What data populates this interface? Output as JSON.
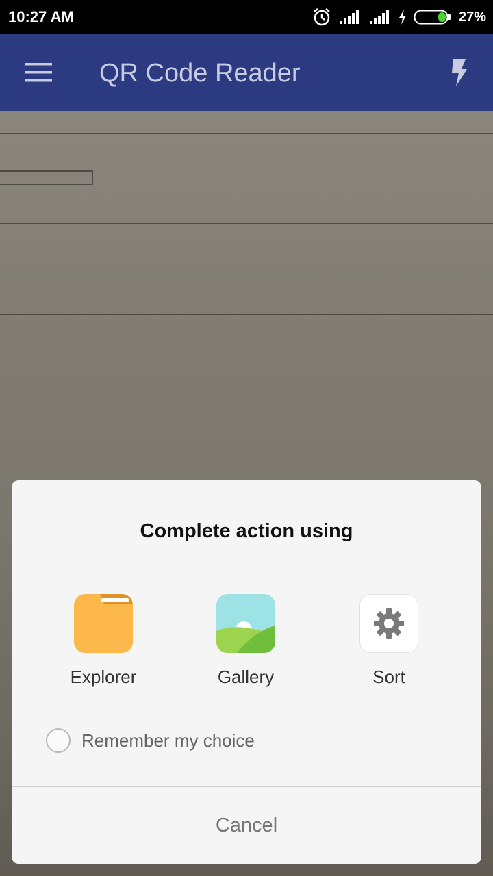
{
  "status_bar": {
    "time": "10:27 AM",
    "battery_percent": "27%",
    "icons": [
      "alarm-icon",
      "signal-icon",
      "signal-icon",
      "charging-icon",
      "battery-icon"
    ]
  },
  "app_bar": {
    "title": "QR Code Reader",
    "menu_icon": "hamburger-menu-icon",
    "flash_icon": "flash-icon",
    "color": "#2c3a82"
  },
  "dialog": {
    "title": "Complete action using",
    "apps": [
      {
        "label": "Explorer",
        "icon": "folder-icon"
      },
      {
        "label": "Gallery",
        "icon": "gallery-icon"
      },
      {
        "label": "Sort",
        "icon": "gear-icon"
      }
    ],
    "remember_label": "Remember my choice",
    "remember_checked": false,
    "cancel_label": "Cancel"
  }
}
